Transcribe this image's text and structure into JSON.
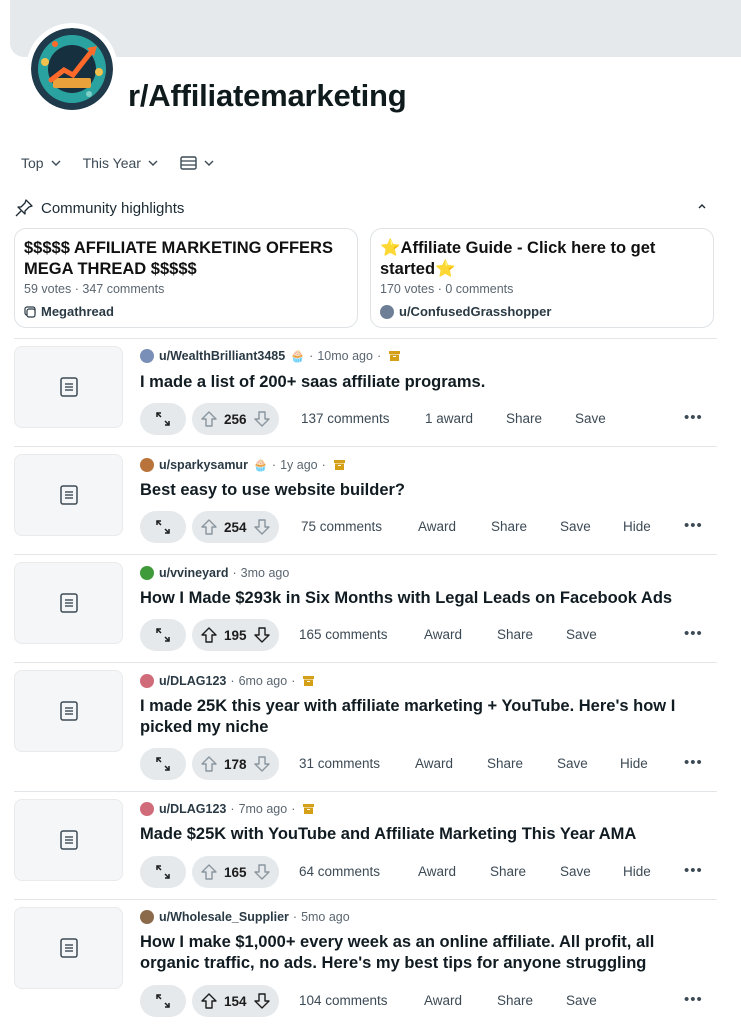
{
  "subreddit": {
    "name": "r/Affiliatemarketing"
  },
  "sort": {
    "primary": "Top",
    "time": "This Year",
    "view_icon": "view-list-icon"
  },
  "highlights": {
    "heading": "Community highlights",
    "cards": [
      {
        "title": "$$$$$ AFFILIATE MARKETING OFFERS MEGA THREAD $$$$$",
        "votes": "59 votes",
        "comments": "347 comments",
        "footer": "Megathread"
      },
      {
        "title": "⭐Affiliate Guide - Click here to get started⭐",
        "votes": "170 votes",
        "comments": "0 comments",
        "footer": "u/ConfusedGrasshopper"
      }
    ]
  },
  "posts": [
    {
      "user": "u/WealthBrilliant3485",
      "time": "10mo ago",
      "title": "I made a list of 200+ saas affiliate programs.",
      "votes": "256",
      "comments": "137 comments",
      "award": "1 award",
      "share": "Share",
      "save": "Save",
      "hide": "",
      "avatar_color": "#7a8fb8"
    },
    {
      "user": "u/sparkysamur",
      "time": "1y ago",
      "title": "Best easy to use website builder?",
      "votes": "254",
      "comments": "75 comments",
      "award": "Award",
      "share": "Share",
      "save": "Save",
      "hide": "Hide",
      "avatar_color": "#b8743a"
    },
    {
      "user": "u/vvineyard",
      "time": "3mo ago",
      "title": "How I Made $293k in Six Months with Legal Leads on Facebook Ads",
      "votes": "195",
      "comments": "165 comments",
      "award": "Award",
      "share": "Share",
      "save": "Save",
      "hide": "",
      "avatar_color": "#3f9b3a"
    },
    {
      "user": "u/DLAG123",
      "time": "6mo ago",
      "title": "I made 25K this year with affiliate marketing + YouTube. Here's how I picked my niche",
      "votes": "178",
      "comments": "31 comments",
      "award": "Award",
      "share": "Share",
      "save": "Save",
      "hide": "Hide",
      "avatar_color": "#d06b7a"
    },
    {
      "user": "u/DLAG123",
      "time": "7mo ago",
      "title": "Made $25K with YouTube and Affiliate Marketing This Year AMA",
      "votes": "165",
      "comments": "64 comments",
      "award": "Award",
      "share": "Share",
      "save": "Save",
      "hide": "Hide",
      "avatar_color": "#d06b7a"
    },
    {
      "user": "u/Wholesale_Supplier",
      "time": "5mo ago",
      "title": "How I make $1,000+ every week as an online affiliate. All profit, all organic traffic, no ads. Here's my best tips for anyone struggling",
      "votes": "154",
      "comments": "104 comments",
      "award": "Award",
      "share": "Share",
      "save": "Save",
      "hide": "",
      "avatar_color": "#8a6a4a"
    }
  ],
  "colors": {
    "banner": "#e5e9ec",
    "pill": "#e5e9ec",
    "archive": "#d4a017"
  }
}
